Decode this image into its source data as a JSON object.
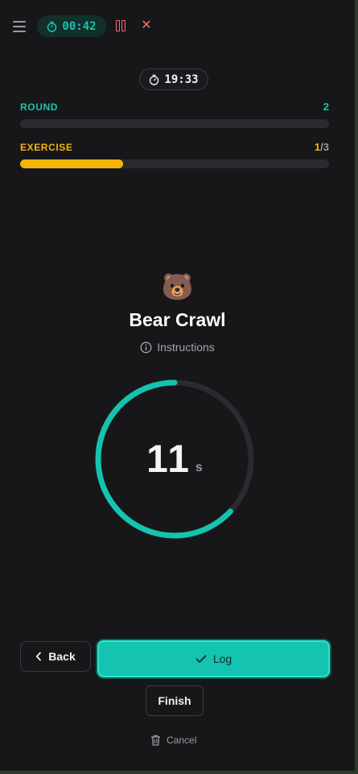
{
  "header": {
    "menu_icon": "hamburger-menu-icon",
    "elapsed_time": "00:42",
    "elapsed_icon": "stopwatch-icon",
    "pause_icon": "pause-icon",
    "close_icon": "close-icon",
    "close_glyph": "✕"
  },
  "total_timer": {
    "time": "19:33",
    "icon": "stopwatch-icon"
  },
  "round": {
    "label": "ROUND",
    "value": "2",
    "progress": 0.0
  },
  "exercise": {
    "label": "EXERCISE",
    "current": "1",
    "total": "/3",
    "progress": 0.333
  },
  "current_exercise": {
    "emoji": "🐻",
    "name": "Bear Crawl",
    "instructions_label": "Instructions",
    "countdown": "11",
    "countdown_unit": "s",
    "countdown_progress": 0.63
  },
  "actions": {
    "back_label": "Back",
    "log_label": "Log",
    "finish_label": "Finish",
    "cancel_label": "Cancel"
  },
  "colors": {
    "accent": "#14c4b0",
    "exercise": "#f5b50a",
    "danger": "#ff6b6b",
    "background": "#17171a"
  }
}
